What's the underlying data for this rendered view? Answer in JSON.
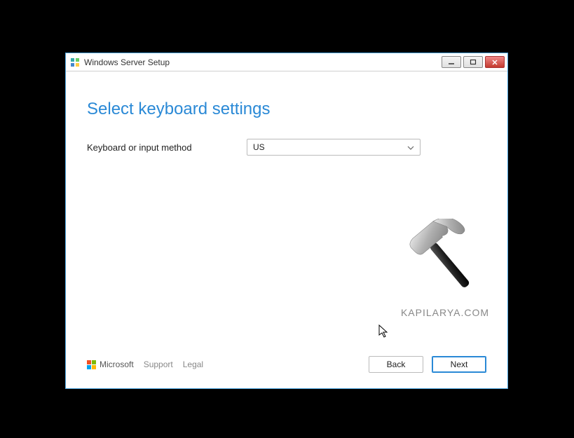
{
  "titlebar": {
    "title": "Windows Server Setup"
  },
  "heading": "Select keyboard settings",
  "form": {
    "keyboard_label": "Keyboard or input method",
    "keyboard_value": "US"
  },
  "watermark": {
    "text": "KAPILARYA.COM"
  },
  "footer": {
    "microsoft": "Microsoft",
    "support": "Support",
    "legal": "Legal",
    "back": "Back",
    "next": "Next"
  }
}
